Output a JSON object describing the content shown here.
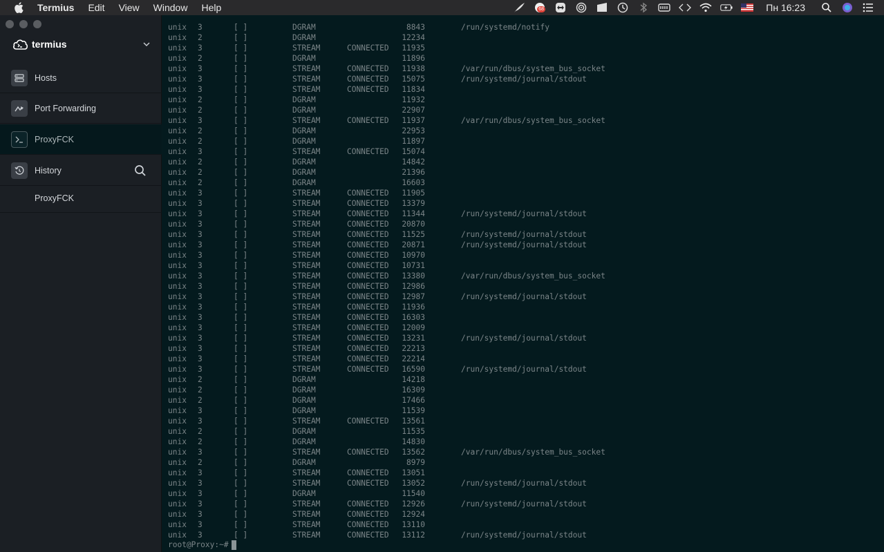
{
  "menubar": {
    "app_name": "Termius",
    "menus": [
      "Edit",
      "View",
      "Window",
      "Help"
    ],
    "badge_count": "68",
    "clock": "Пн 16:23"
  },
  "sidebar": {
    "brand": "termius",
    "items": [
      {
        "label": "Hosts"
      },
      {
        "label": "Port Forwarding"
      },
      {
        "label": "ProxyFCK"
      },
      {
        "label": "History"
      }
    ],
    "history_entry": "ProxyFCK"
  },
  "terminal": {
    "rows": [
      [
        "unix",
        "3",
        "[ ]",
        "DGRAM",
        "",
        "8843",
        "/run/systemd/notify"
      ],
      [
        "unix",
        "2",
        "[ ]",
        "DGRAM",
        "",
        "12234",
        ""
      ],
      [
        "unix",
        "3",
        "[ ]",
        "STREAM",
        "CONNECTED",
        "11935",
        ""
      ],
      [
        "unix",
        "2",
        "[ ]",
        "DGRAM",
        "",
        "11896",
        ""
      ],
      [
        "unix",
        "3",
        "[ ]",
        "STREAM",
        "CONNECTED",
        "11938",
        "/var/run/dbus/system_bus_socket"
      ],
      [
        "unix",
        "3",
        "[ ]",
        "STREAM",
        "CONNECTED",
        "15075",
        "/run/systemd/journal/stdout"
      ],
      [
        "unix",
        "3",
        "[ ]",
        "STREAM",
        "CONNECTED",
        "11834",
        ""
      ],
      [
        "unix",
        "2",
        "[ ]",
        "DGRAM",
        "",
        "11932",
        ""
      ],
      [
        "unix",
        "2",
        "[ ]",
        "DGRAM",
        "",
        "22907",
        ""
      ],
      [
        "unix",
        "3",
        "[ ]",
        "STREAM",
        "CONNECTED",
        "11937",
        "/var/run/dbus/system_bus_socket"
      ],
      [
        "unix",
        "2",
        "[ ]",
        "DGRAM",
        "",
        "22953",
        ""
      ],
      [
        "unix",
        "2",
        "[ ]",
        "DGRAM",
        "",
        "11897",
        ""
      ],
      [
        "unix",
        "3",
        "[ ]",
        "STREAM",
        "CONNECTED",
        "15074",
        ""
      ],
      [
        "unix",
        "2",
        "[ ]",
        "DGRAM",
        "",
        "14842",
        ""
      ],
      [
        "unix",
        "2",
        "[ ]",
        "DGRAM",
        "",
        "21396",
        ""
      ],
      [
        "unix",
        "2",
        "[ ]",
        "DGRAM",
        "",
        "16603",
        ""
      ],
      [
        "unix",
        "3",
        "[ ]",
        "STREAM",
        "CONNECTED",
        "11905",
        ""
      ],
      [
        "unix",
        "3",
        "[ ]",
        "STREAM",
        "CONNECTED",
        "13379",
        ""
      ],
      [
        "unix",
        "3",
        "[ ]",
        "STREAM",
        "CONNECTED",
        "11344",
        "/run/systemd/journal/stdout"
      ],
      [
        "unix",
        "3",
        "[ ]",
        "STREAM",
        "CONNECTED",
        "20870",
        ""
      ],
      [
        "unix",
        "3",
        "[ ]",
        "STREAM",
        "CONNECTED",
        "11525",
        "/run/systemd/journal/stdout"
      ],
      [
        "unix",
        "3",
        "[ ]",
        "STREAM",
        "CONNECTED",
        "20871",
        "/run/systemd/journal/stdout"
      ],
      [
        "unix",
        "3",
        "[ ]",
        "STREAM",
        "CONNECTED",
        "10970",
        ""
      ],
      [
        "unix",
        "3",
        "[ ]",
        "STREAM",
        "CONNECTED",
        "10731",
        ""
      ],
      [
        "unix",
        "3",
        "[ ]",
        "STREAM",
        "CONNECTED",
        "13380",
        "/var/run/dbus/system_bus_socket"
      ],
      [
        "unix",
        "3",
        "[ ]",
        "STREAM",
        "CONNECTED",
        "12986",
        ""
      ],
      [
        "unix",
        "3",
        "[ ]",
        "STREAM",
        "CONNECTED",
        "12987",
        "/run/systemd/journal/stdout"
      ],
      [
        "unix",
        "3",
        "[ ]",
        "STREAM",
        "CONNECTED",
        "11936",
        ""
      ],
      [
        "unix",
        "3",
        "[ ]",
        "STREAM",
        "CONNECTED",
        "16303",
        ""
      ],
      [
        "unix",
        "3",
        "[ ]",
        "STREAM",
        "CONNECTED",
        "12009",
        ""
      ],
      [
        "unix",
        "3",
        "[ ]",
        "STREAM",
        "CONNECTED",
        "13231",
        "/run/systemd/journal/stdout"
      ],
      [
        "unix",
        "3",
        "[ ]",
        "STREAM",
        "CONNECTED",
        "22213",
        ""
      ],
      [
        "unix",
        "3",
        "[ ]",
        "STREAM",
        "CONNECTED",
        "22214",
        ""
      ],
      [
        "unix",
        "3",
        "[ ]",
        "STREAM",
        "CONNECTED",
        "16590",
        "/run/systemd/journal/stdout"
      ],
      [
        "unix",
        "2",
        "[ ]",
        "DGRAM",
        "",
        "14218",
        ""
      ],
      [
        "unix",
        "2",
        "[ ]",
        "DGRAM",
        "",
        "16309",
        ""
      ],
      [
        "unix",
        "2",
        "[ ]",
        "DGRAM",
        "",
        "17466",
        ""
      ],
      [
        "unix",
        "3",
        "[ ]",
        "DGRAM",
        "",
        "11539",
        ""
      ],
      [
        "unix",
        "3",
        "[ ]",
        "STREAM",
        "CONNECTED",
        "13561",
        ""
      ],
      [
        "unix",
        "2",
        "[ ]",
        "DGRAM",
        "",
        "11535",
        ""
      ],
      [
        "unix",
        "2",
        "[ ]",
        "DGRAM",
        "",
        "14830",
        ""
      ],
      [
        "unix",
        "3",
        "[ ]",
        "STREAM",
        "CONNECTED",
        "13562",
        "/var/run/dbus/system_bus_socket"
      ],
      [
        "unix",
        "2",
        "[ ]",
        "DGRAM",
        "",
        "8979",
        ""
      ],
      [
        "unix",
        "3",
        "[ ]",
        "STREAM",
        "CONNECTED",
        "13051",
        ""
      ],
      [
        "unix",
        "3",
        "[ ]",
        "STREAM",
        "CONNECTED",
        "13052",
        "/run/systemd/journal/stdout"
      ],
      [
        "unix",
        "3",
        "[ ]",
        "DGRAM",
        "",
        "11540",
        ""
      ],
      [
        "unix",
        "3",
        "[ ]",
        "STREAM",
        "CONNECTED",
        "12926",
        "/run/systemd/journal/stdout"
      ],
      [
        "unix",
        "3",
        "[ ]",
        "STREAM",
        "CONNECTED",
        "12924",
        ""
      ],
      [
        "unix",
        "3",
        "[ ]",
        "STREAM",
        "CONNECTED",
        "13110",
        ""
      ],
      [
        "unix",
        "3",
        "[ ]",
        "STREAM",
        "CONNECTED",
        "13112",
        "/run/systemd/journal/stdout"
      ]
    ],
    "prompt": "root@Proxy:~#"
  }
}
